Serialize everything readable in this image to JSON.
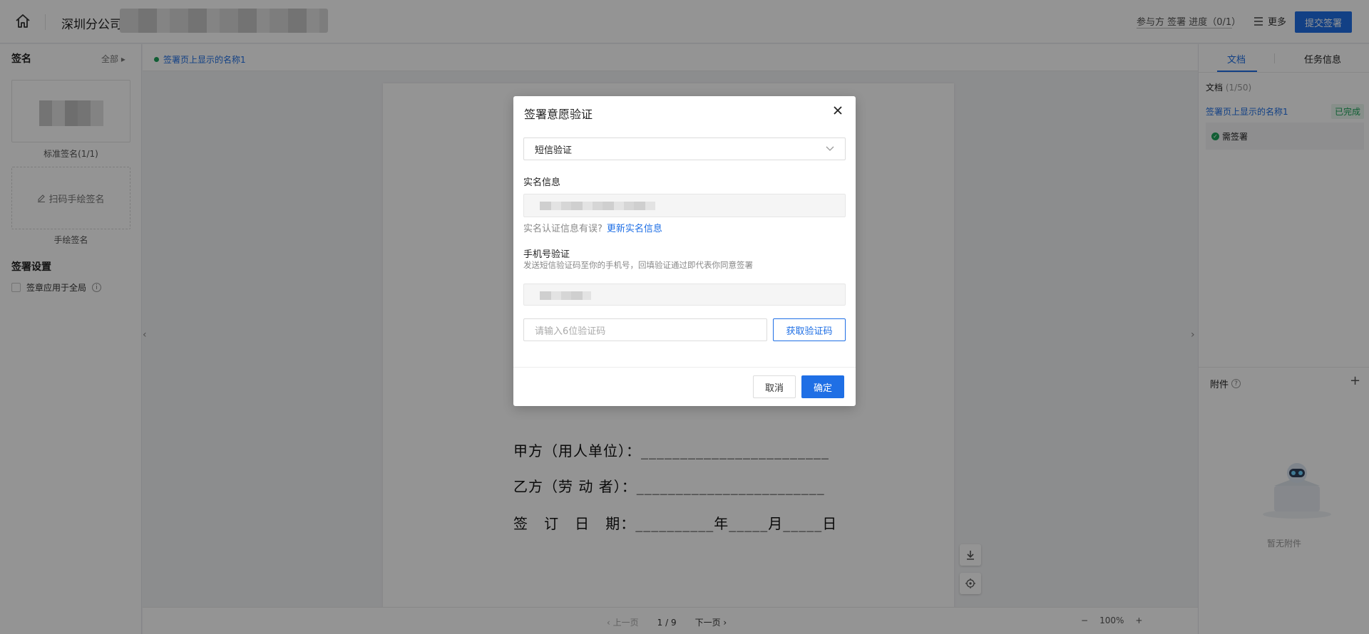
{
  "header": {
    "title": "深圳分公司",
    "progress": "参与方 签署 进度（0/1）",
    "more": "更多",
    "submit": "提交签署"
  },
  "left": {
    "signature_title": "签名",
    "all": "全部",
    "standard_caption": "标准签名(1/1)",
    "scan_hand": "扫码手绘签名",
    "hand_caption": "手绘签名",
    "settings_title": "签署设置",
    "apply_all": "签章应用于全局"
  },
  "center": {
    "signer_name": "签署页上显示的名称1",
    "contract_lines": [
      "甲方（用人单位）：________________________",
      "乙方（劳 动 者）：________________________",
      "签   订   日   期：__________年_____月_____日"
    ],
    "prev": "上一页",
    "page": "1 / 9",
    "next": "下一页",
    "zoom": "100%"
  },
  "right": {
    "tab_doc": "文档",
    "tab_task": "任务信息",
    "doc_label": "文档",
    "doc_count": "(1/50)",
    "doc_name": "签署页上显示的名称1",
    "done": "已完成",
    "need_sign": "需签署",
    "attach": "附件",
    "no_attach": "暂无附件"
  },
  "modal": {
    "title": "签署意愿验证",
    "method": "短信验证",
    "realname_label": "实名信息",
    "realname_error": "实名认证信息有误?",
    "update_link": "更新实名信息",
    "phone_label": "手机号验证",
    "phone_desc": "发送短信验证码至你的手机号，回填验证通过即代表你同意签署",
    "code_placeholder": "请输入6位验证码",
    "get_code": "获取验证码",
    "cancel": "取消",
    "ok": "确定"
  },
  "colors": {
    "primary": "#1f6fe5",
    "success": "#1ea35a"
  },
  "icons": [
    "home-icon",
    "menu-icon",
    "edit-icon",
    "info-icon",
    "download-icon",
    "locate-icon",
    "close-icon",
    "chevron-down-icon"
  ]
}
